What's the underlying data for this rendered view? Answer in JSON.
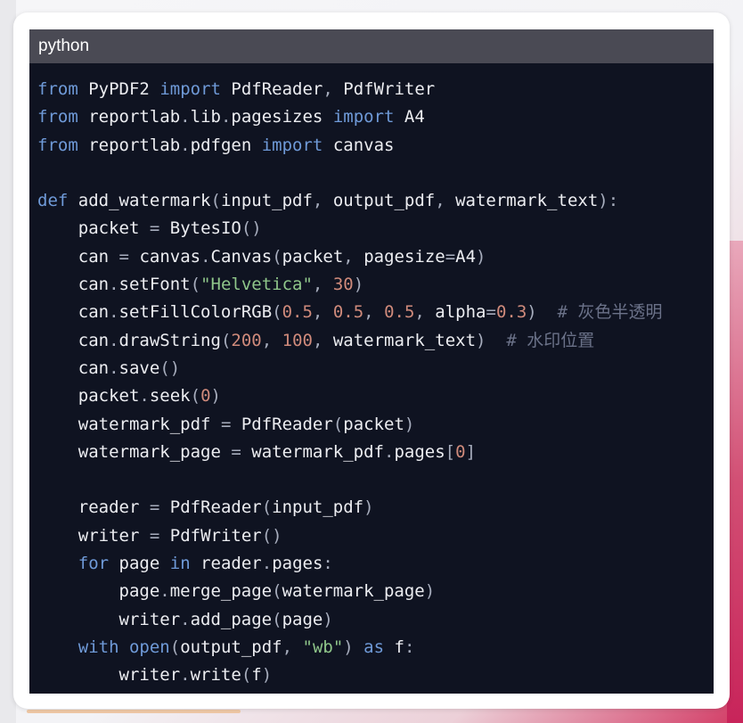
{
  "code_block": {
    "language": "python",
    "lines": [
      [
        [
          "kw",
          "from"
        ],
        [
          "sp",
          " "
        ],
        [
          "id",
          "PyPDF2"
        ],
        [
          "sp",
          " "
        ],
        [
          "kw",
          "import"
        ],
        [
          "sp",
          " "
        ],
        [
          "id",
          "PdfReader"
        ],
        [
          "pun",
          ","
        ],
        [
          "sp",
          " "
        ],
        [
          "id",
          "PdfWriter"
        ]
      ],
      [
        [
          "kw",
          "from"
        ],
        [
          "sp",
          " "
        ],
        [
          "id",
          "reportlab"
        ],
        [
          "pun",
          "."
        ],
        [
          "id",
          "lib"
        ],
        [
          "pun",
          "."
        ],
        [
          "id",
          "pagesizes"
        ],
        [
          "sp",
          " "
        ],
        [
          "kw",
          "import"
        ],
        [
          "sp",
          " "
        ],
        [
          "id",
          "A4"
        ]
      ],
      [
        [
          "kw",
          "from"
        ],
        [
          "sp",
          " "
        ],
        [
          "id",
          "reportlab"
        ],
        [
          "pun",
          "."
        ],
        [
          "id",
          "pdfgen"
        ],
        [
          "sp",
          " "
        ],
        [
          "kw",
          "import"
        ],
        [
          "sp",
          " "
        ],
        [
          "id",
          "canvas"
        ]
      ],
      [],
      [
        [
          "kw",
          "def"
        ],
        [
          "sp",
          " "
        ],
        [
          "fn",
          "add_watermark"
        ],
        [
          "pun",
          "("
        ],
        [
          "id",
          "input_pdf"
        ],
        [
          "pun",
          ","
        ],
        [
          "sp",
          " "
        ],
        [
          "id",
          "output_pdf"
        ],
        [
          "pun",
          ","
        ],
        [
          "sp",
          " "
        ],
        [
          "id",
          "watermark_text"
        ],
        [
          "pun",
          "):"
        ]
      ],
      [
        [
          "sp",
          "    "
        ],
        [
          "id",
          "packet"
        ],
        [
          "sp",
          " "
        ],
        [
          "op",
          "="
        ],
        [
          "sp",
          " "
        ],
        [
          "id",
          "BytesIO"
        ],
        [
          "pun",
          "()"
        ]
      ],
      [
        [
          "sp",
          "    "
        ],
        [
          "id",
          "can"
        ],
        [
          "sp",
          " "
        ],
        [
          "op",
          "="
        ],
        [
          "sp",
          " "
        ],
        [
          "id",
          "canvas"
        ],
        [
          "pun",
          "."
        ],
        [
          "id",
          "Canvas"
        ],
        [
          "pun",
          "("
        ],
        [
          "id",
          "packet"
        ],
        [
          "pun",
          ","
        ],
        [
          "sp",
          " "
        ],
        [
          "id",
          "pagesize"
        ],
        [
          "op",
          "="
        ],
        [
          "id",
          "A4"
        ],
        [
          "pun",
          ")"
        ]
      ],
      [
        [
          "sp",
          "    "
        ],
        [
          "id",
          "can"
        ],
        [
          "pun",
          "."
        ],
        [
          "id",
          "setFont"
        ],
        [
          "pun",
          "("
        ],
        [
          "str",
          "\"Helvetica\""
        ],
        [
          "pun",
          ","
        ],
        [
          "sp",
          " "
        ],
        [
          "num",
          "30"
        ],
        [
          "pun",
          ")"
        ]
      ],
      [
        [
          "sp",
          "    "
        ],
        [
          "id",
          "can"
        ],
        [
          "pun",
          "."
        ],
        [
          "id",
          "setFillColorRGB"
        ],
        [
          "pun",
          "("
        ],
        [
          "num",
          "0.5"
        ],
        [
          "pun",
          ","
        ],
        [
          "sp",
          " "
        ],
        [
          "num",
          "0.5"
        ],
        [
          "pun",
          ","
        ],
        [
          "sp",
          " "
        ],
        [
          "num",
          "0.5"
        ],
        [
          "pun",
          ","
        ],
        [
          "sp",
          " "
        ],
        [
          "id",
          "alpha"
        ],
        [
          "op",
          "="
        ],
        [
          "num",
          "0.3"
        ],
        [
          "pun",
          ")"
        ],
        [
          "sp",
          "  "
        ],
        [
          "cmt",
          "# 灰色半透明"
        ]
      ],
      [
        [
          "sp",
          "    "
        ],
        [
          "id",
          "can"
        ],
        [
          "pun",
          "."
        ],
        [
          "id",
          "drawString"
        ],
        [
          "pun",
          "("
        ],
        [
          "num",
          "200"
        ],
        [
          "pun",
          ","
        ],
        [
          "sp",
          " "
        ],
        [
          "num",
          "100"
        ],
        [
          "pun",
          ","
        ],
        [
          "sp",
          " "
        ],
        [
          "id",
          "watermark_text"
        ],
        [
          "pun",
          ")"
        ],
        [
          "sp",
          "  "
        ],
        [
          "cmt",
          "# 水印位置"
        ]
      ],
      [
        [
          "sp",
          "    "
        ],
        [
          "id",
          "can"
        ],
        [
          "pun",
          "."
        ],
        [
          "id",
          "save"
        ],
        [
          "pun",
          "()"
        ]
      ],
      [
        [
          "sp",
          "    "
        ],
        [
          "id",
          "packet"
        ],
        [
          "pun",
          "."
        ],
        [
          "id",
          "seek"
        ],
        [
          "pun",
          "("
        ],
        [
          "num",
          "0"
        ],
        [
          "pun",
          ")"
        ]
      ],
      [
        [
          "sp",
          "    "
        ],
        [
          "id",
          "watermark_pdf"
        ],
        [
          "sp",
          " "
        ],
        [
          "op",
          "="
        ],
        [
          "sp",
          " "
        ],
        [
          "id",
          "PdfReader"
        ],
        [
          "pun",
          "("
        ],
        [
          "id",
          "packet"
        ],
        [
          "pun",
          ")"
        ]
      ],
      [
        [
          "sp",
          "    "
        ],
        [
          "id",
          "watermark_page"
        ],
        [
          "sp",
          " "
        ],
        [
          "op",
          "="
        ],
        [
          "sp",
          " "
        ],
        [
          "id",
          "watermark_pdf"
        ],
        [
          "pun",
          "."
        ],
        [
          "id",
          "pages"
        ],
        [
          "pun",
          "["
        ],
        [
          "num",
          "0"
        ],
        [
          "pun",
          "]"
        ]
      ],
      [],
      [
        [
          "sp",
          "    "
        ],
        [
          "id",
          "reader"
        ],
        [
          "sp",
          " "
        ],
        [
          "op",
          "="
        ],
        [
          "sp",
          " "
        ],
        [
          "id",
          "PdfReader"
        ],
        [
          "pun",
          "("
        ],
        [
          "id",
          "input_pdf"
        ],
        [
          "pun",
          ")"
        ]
      ],
      [
        [
          "sp",
          "    "
        ],
        [
          "id",
          "writer"
        ],
        [
          "sp",
          " "
        ],
        [
          "op",
          "="
        ],
        [
          "sp",
          " "
        ],
        [
          "id",
          "PdfWriter"
        ],
        [
          "pun",
          "()"
        ]
      ],
      [
        [
          "sp",
          "    "
        ],
        [
          "kw",
          "for"
        ],
        [
          "sp",
          " "
        ],
        [
          "id",
          "page"
        ],
        [
          "sp",
          " "
        ],
        [
          "kw",
          "in"
        ],
        [
          "sp",
          " "
        ],
        [
          "id",
          "reader"
        ],
        [
          "pun",
          "."
        ],
        [
          "id",
          "pages"
        ],
        [
          "pun",
          ":"
        ]
      ],
      [
        [
          "sp",
          "        "
        ],
        [
          "id",
          "page"
        ],
        [
          "pun",
          "."
        ],
        [
          "id",
          "merge_page"
        ],
        [
          "pun",
          "("
        ],
        [
          "id",
          "watermark_page"
        ],
        [
          "pun",
          ")"
        ]
      ],
      [
        [
          "sp",
          "        "
        ],
        [
          "id",
          "writer"
        ],
        [
          "pun",
          "."
        ],
        [
          "id",
          "add_page"
        ],
        [
          "pun",
          "("
        ],
        [
          "id",
          "page"
        ],
        [
          "pun",
          ")"
        ]
      ],
      [
        [
          "sp",
          "    "
        ],
        [
          "kw",
          "with"
        ],
        [
          "sp",
          " "
        ],
        [
          "kw",
          "open"
        ],
        [
          "pun",
          "("
        ],
        [
          "id",
          "output_pdf"
        ],
        [
          "pun",
          ","
        ],
        [
          "sp",
          " "
        ],
        [
          "str",
          "\"wb\""
        ],
        [
          "pun",
          ")"
        ],
        [
          "sp",
          " "
        ],
        [
          "kw",
          "as"
        ],
        [
          "sp",
          " "
        ],
        [
          "id",
          "f"
        ],
        [
          "pun",
          ":"
        ]
      ],
      [
        [
          "sp",
          "        "
        ],
        [
          "id",
          "writer"
        ],
        [
          "pun",
          "."
        ],
        [
          "id",
          "write"
        ],
        [
          "pun",
          "("
        ],
        [
          "id",
          "f"
        ],
        [
          "pun",
          ")"
        ]
      ]
    ]
  }
}
